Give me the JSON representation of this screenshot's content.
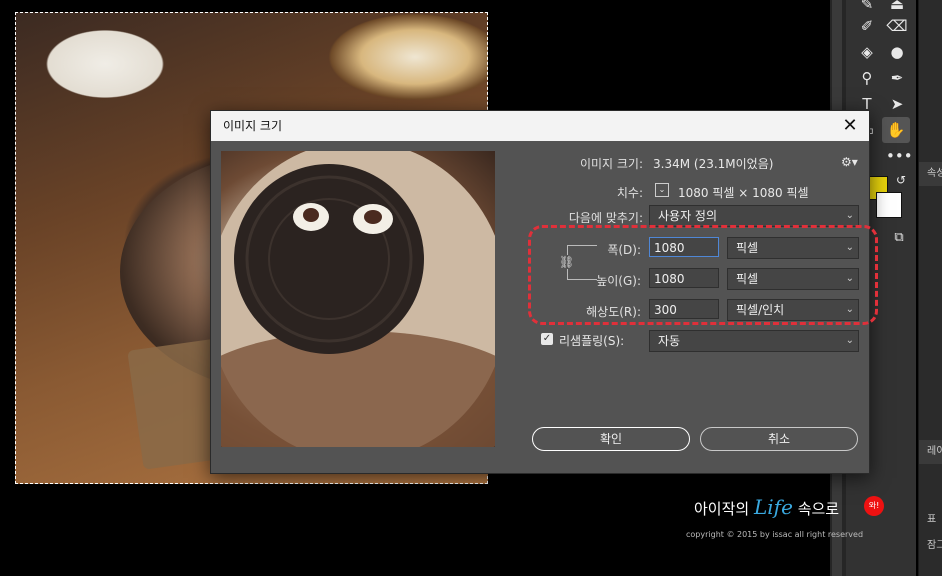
{
  "dialog": {
    "title": "이미지 크기",
    "image_size_label": "이미지 크기:",
    "image_size_value": "3.34M (23.1M이었음)",
    "dimensions_label": "치수:",
    "dimensions_value": "1080 픽셀 × 1080 픽셀",
    "fit_to_label": "다음에 맞추기:",
    "fit_to_value": "사용자 정의",
    "width_label": "폭(D):",
    "width_value": "1080",
    "width_unit": "픽셀",
    "height_label": "높이(G):",
    "height_value": "1080",
    "height_unit": "픽셀",
    "resolution_label": "해상도(R):",
    "resolution_value": "300",
    "resolution_unit": "픽셀/인치",
    "resample_label": "리샘플링(S):",
    "resample_value": "자동",
    "resample_checked": true,
    "ok_label": "확인",
    "cancel_label": "취소",
    "close_glyph": "✕",
    "gear_glyph": "⚙▾",
    "chain_glyph": "⛓"
  },
  "watermark": {
    "prefix": "아이작의",
    "life": "Life",
    "suffix": "속으로",
    "stamp": "와!",
    "copyright": "copyright © 2015 by issac all right reserved"
  },
  "right_panel": {
    "tab1": "속성",
    "tab2": "레이어",
    "tab3": "표",
    "tab4": "잠그"
  },
  "colors": {
    "accent_highlight": "#e0303a",
    "foreground_swatch": "#e6d20c",
    "background_swatch": "#ffffff",
    "dialog_bg": "#535353",
    "focus_border": "#4f87d6"
  },
  "icons": [
    "brush-icon",
    "eraser-icon",
    "paint-bucket-icon",
    "blur-icon",
    "dodge-icon",
    "pen-icon",
    "type-icon",
    "path-select-icon",
    "rectangle-icon",
    "hand-icon",
    "more-icon",
    "swap-colors-icon",
    "screen-mode-icon"
  ]
}
